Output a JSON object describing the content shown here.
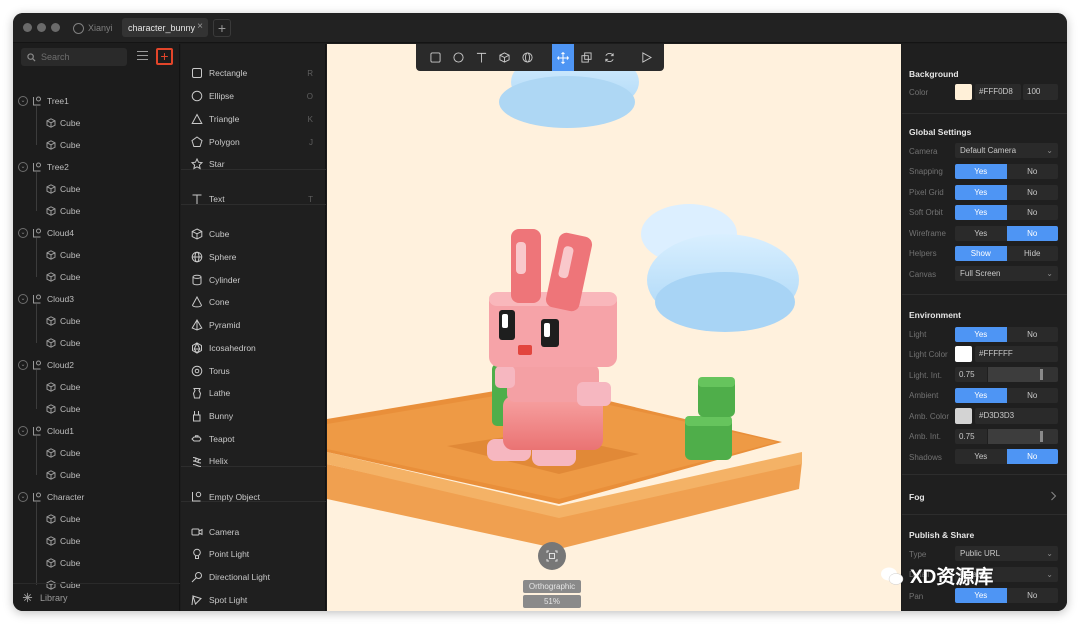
{
  "titlebar": {
    "user_tab": "Xianyi",
    "doc_tab": "character_bunny"
  },
  "tree": {
    "search_placeholder": "Search",
    "groups": [
      {
        "label": "Tree1",
        "children": [
          "Cube",
          "Cube"
        ]
      },
      {
        "label": "Tree2",
        "children": [
          "Cube",
          "Cube"
        ]
      },
      {
        "label": "Cloud4",
        "children": [
          "Cube",
          "Cube"
        ]
      },
      {
        "label": "Cloud3",
        "children": [
          "Cube",
          "Cube"
        ]
      },
      {
        "label": "Cloud2",
        "children": [
          "Cube",
          "Cube"
        ]
      },
      {
        "label": "Cloud1",
        "children": [
          "Cube",
          "Cube"
        ]
      },
      {
        "label": "Character",
        "children": [
          "Cube",
          "Cube",
          "Cube",
          "Cube"
        ]
      }
    ],
    "library_label": "Library"
  },
  "shapes": {
    "items": [
      {
        "label": "Rectangle",
        "key": "R",
        "icon": "rectangle-icon"
      },
      {
        "label": "Ellipse",
        "key": "O",
        "icon": "ellipse-icon"
      },
      {
        "label": "Triangle",
        "key": "K",
        "icon": "triangle-icon"
      },
      {
        "label": "Polygon",
        "key": "J",
        "icon": "polygon-icon"
      },
      {
        "label": "Star",
        "key": "",
        "icon": "star-icon"
      },
      {
        "label": "Text",
        "key": "T",
        "icon": "text-icon"
      },
      {
        "label": "Cube",
        "key": "",
        "icon": "cube-icon"
      },
      {
        "label": "Sphere",
        "key": "",
        "icon": "sphere-icon"
      },
      {
        "label": "Cylinder",
        "key": "",
        "icon": "cylinder-icon"
      },
      {
        "label": "Cone",
        "key": "",
        "icon": "cone-icon"
      },
      {
        "label": "Pyramid",
        "key": "",
        "icon": "pyramid-icon"
      },
      {
        "label": "Icosahedron",
        "key": "",
        "icon": "icosahedron-icon"
      },
      {
        "label": "Torus",
        "key": "",
        "icon": "torus-icon"
      },
      {
        "label": "Lathe",
        "key": "",
        "icon": "lathe-icon"
      },
      {
        "label": "Bunny",
        "key": "",
        "icon": "bunny-icon"
      },
      {
        "label": "Teapot",
        "key": "",
        "icon": "teapot-icon"
      },
      {
        "label": "Helix",
        "key": "",
        "icon": "helix-icon"
      },
      {
        "label": "Empty Object",
        "key": "",
        "icon": "empty-object-icon"
      },
      {
        "label": "Camera",
        "key": "",
        "icon": "camera-icon"
      },
      {
        "label": "Point Light",
        "key": "",
        "icon": "point-light-icon"
      },
      {
        "label": "Directional Light",
        "key": "",
        "icon": "directional-light-icon"
      },
      {
        "label": "Spot Light",
        "key": "",
        "icon": "spot-light-icon"
      }
    ]
  },
  "canvas": {
    "background": "#FFF1DD",
    "view_label": "Orthographic",
    "zoom_label": "51%"
  },
  "props": {
    "background": {
      "title": "Background",
      "color_label": "Color",
      "color_hex": "#FFF0D8",
      "opacity": "100",
      "swatch": "#FFF0D8"
    },
    "global": {
      "title": "Global Settings",
      "camera_label": "Camera",
      "camera_value": "Default Camera",
      "snapping_label": "Snapping",
      "pixel_grid_label": "Pixel Grid",
      "soft_orbit_label": "Soft Orbit",
      "wireframe_label": "Wireframe",
      "helpers_label": "Helpers",
      "show": "Show",
      "hide": "Hide",
      "canvas_label": "Canvas",
      "canvas_value": "Full Screen",
      "yes": "Yes",
      "no": "No"
    },
    "environment": {
      "title": "Environment",
      "light_label": "Light",
      "light_color_label": "Light Color",
      "light_color_hex": "#FFFFFF",
      "light_int_label": "Light. Int.",
      "light_int_value": "0.75",
      "ambient_label": "Ambient",
      "amb_color_label": "Amb. Color",
      "amb_color_hex": "#D3D3D3",
      "amb_int_label": "Amb. Int.",
      "amb_int_value": "0.75",
      "shadows_label": "Shadows",
      "yes": "Yes",
      "no": "No"
    },
    "fog": {
      "title": "Fog"
    },
    "publish": {
      "title": "Publish & Share",
      "type_label": "Type",
      "type_value": "Public URL",
      "detail_label": "Detail",
      "detail_value": "Default",
      "pan_label": "Pan",
      "yes": "Yes",
      "no": "No"
    }
  },
  "watermark": "XD资源库"
}
